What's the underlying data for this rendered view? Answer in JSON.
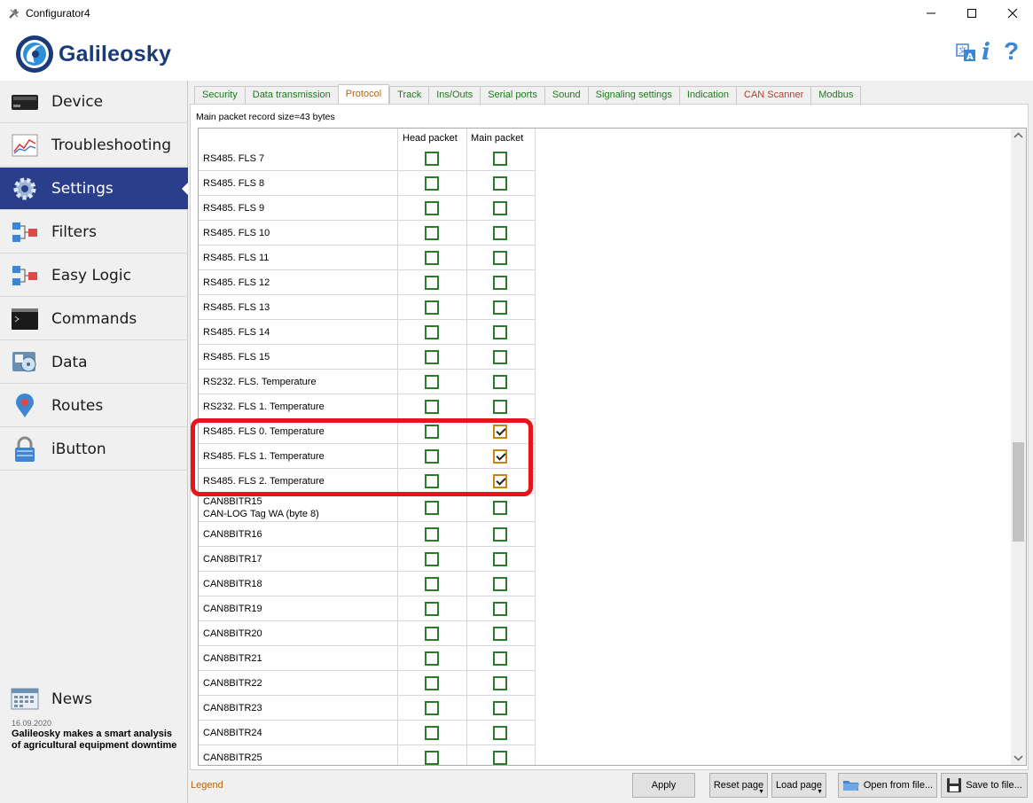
{
  "window": {
    "title": "Configurator4"
  },
  "header": {
    "brand": "Galileosky"
  },
  "sidebar": {
    "items": [
      {
        "label": "Device",
        "icon": "device-icon"
      },
      {
        "label": "Troubleshooting",
        "icon": "chart-icon"
      },
      {
        "label": "Settings",
        "icon": "gear-icon",
        "active": true
      },
      {
        "label": "Filters",
        "icon": "filter-blocks-icon"
      },
      {
        "label": "Easy Logic",
        "icon": "logic-blocks-icon"
      },
      {
        "label": "Commands",
        "icon": "terminal-icon"
      },
      {
        "label": "Data",
        "icon": "database-icon"
      },
      {
        "label": "Routes",
        "icon": "map-pin-icon"
      },
      {
        "label": "iButton",
        "icon": "lock-icon"
      }
    ],
    "news": {
      "label": "News",
      "date": "16.09.2020",
      "headline": "Galileosky makes a smart analysis of agricultural equipment downtime"
    }
  },
  "tabs": [
    {
      "label": "Security"
    },
    {
      "label": "Data transmission"
    },
    {
      "label": "Protocol",
      "active": true
    },
    {
      "label": "Track"
    },
    {
      "label": "Ins/Outs"
    },
    {
      "label": "Serial ports"
    },
    {
      "label": "Sound"
    },
    {
      "label": "Signaling settings"
    },
    {
      "label": "Indication"
    },
    {
      "label": "CAN Scanner",
      "red": true
    },
    {
      "label": "Modbus"
    }
  ],
  "protocol": {
    "record_size": "Main packet record size=43 bytes",
    "columns": {
      "name": "",
      "head": "Head packet",
      "main": "Main packet"
    },
    "rows": [
      {
        "name": "RS485. FLS 7",
        "head": false,
        "main": false
      },
      {
        "name": "RS485. FLS 8",
        "head": false,
        "main": false
      },
      {
        "name": "RS485. FLS 9",
        "head": false,
        "main": false
      },
      {
        "name": "RS485. FLS 10",
        "head": false,
        "main": false
      },
      {
        "name": "RS485. FLS 11",
        "head": false,
        "main": false
      },
      {
        "name": "RS485. FLS 12",
        "head": false,
        "main": false
      },
      {
        "name": "RS485. FLS 13",
        "head": false,
        "main": false
      },
      {
        "name": "RS485. FLS 14",
        "head": false,
        "main": false
      },
      {
        "name": "RS485. FLS 15",
        "head": false,
        "main": false
      },
      {
        "name": "RS232. FLS. Temperature",
        "head": false,
        "main": false
      },
      {
        "name": "RS232. FLS 1. Temperature",
        "head": false,
        "main": false
      },
      {
        "name": "RS485. FLS 0. Temperature",
        "head": false,
        "main": true
      },
      {
        "name": "RS485. FLS 1. Temperature",
        "head": false,
        "main": true
      },
      {
        "name": "RS485. FLS 2. Temperature",
        "head": false,
        "main": true
      },
      {
        "name": "CAN8BITR15\nCAN-LOG Tag WA (byte 8)",
        "head": false,
        "main": false,
        "tall": true
      },
      {
        "name": "CAN8BITR16",
        "head": false,
        "main": false
      },
      {
        "name": "CAN8BITR17",
        "head": false,
        "main": false
      },
      {
        "name": "CAN8BITR18",
        "head": false,
        "main": false
      },
      {
        "name": "CAN8BITR19",
        "head": false,
        "main": false
      },
      {
        "name": "CAN8BITR20",
        "head": false,
        "main": false
      },
      {
        "name": "CAN8BITR21",
        "head": false,
        "main": false
      },
      {
        "name": "CAN8BITR22",
        "head": false,
        "main": false
      },
      {
        "name": "CAN8BITR23",
        "head": false,
        "main": false
      },
      {
        "name": "CAN8BITR24",
        "head": false,
        "main": false
      },
      {
        "name": "CAN8BITR25",
        "head": false,
        "main": false
      }
    ]
  },
  "footer": {
    "legend": "Legend",
    "apply": "Apply",
    "reset_page": "Reset page",
    "load_page": "Load page",
    "open_from_file": "Open from file...",
    "save_to_file": "Save to file..."
  },
  "colors": {
    "sidebar_active": "#2a3e8c",
    "checkbox_green": "#2b7a2b",
    "checkbox_checked": "#c8850f",
    "highlight_red": "#e8141c",
    "tab_active_text": "#b5650a"
  }
}
